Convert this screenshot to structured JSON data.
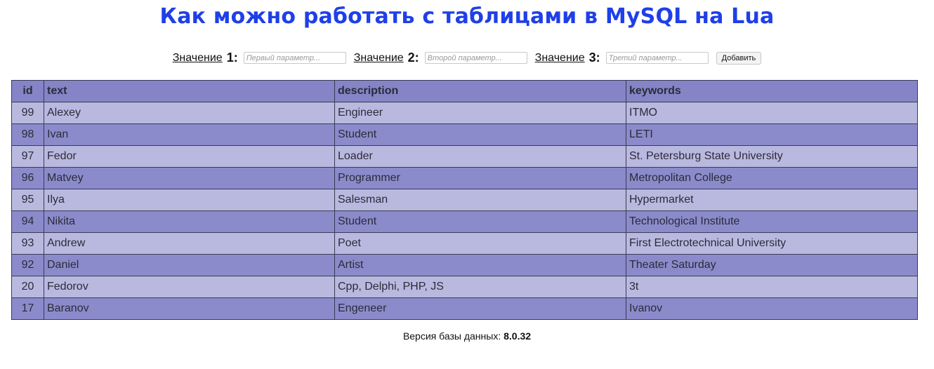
{
  "page": {
    "title": "Как можно работать с таблицами в MySQL на Lua"
  },
  "form": {
    "fields": [
      {
        "label": "Значение",
        "number": "1:",
        "placeholder": "Первый параметр..."
      },
      {
        "label": "Значение",
        "number": "2:",
        "placeholder": "Второй параметр..."
      },
      {
        "label": "Значение",
        "number": "3:",
        "placeholder": "Третий параметр..."
      }
    ],
    "submit_label": "Добавить"
  },
  "table": {
    "headers": [
      "id",
      "text",
      "description",
      "keywords"
    ],
    "rows": [
      [
        "99",
        "Alexey",
        "Engineer",
        "ITMO"
      ],
      [
        "98",
        "Ivan",
        "Student",
        "LETI"
      ],
      [
        "97",
        "Fedor",
        "Loader",
        "St. Petersburg State University"
      ],
      [
        "96",
        "Matvey",
        "Programmer",
        "Metropolitan College"
      ],
      [
        "95",
        "Ilya",
        "Salesman",
        "Hypermarket"
      ],
      [
        "94",
        "Nikita",
        "Student",
        "Technological Institute"
      ],
      [
        "93",
        "Andrew",
        "Poet",
        "First Electrotechnical University"
      ],
      [
        "92",
        "Daniel",
        "Artist",
        "Theater Saturday"
      ],
      [
        "20",
        "Fedorov",
        "Cpp, Delphi, PHP, JS",
        "3t"
      ],
      [
        "17",
        "Baranov",
        "Engeneer",
        "Ivanov"
      ]
    ]
  },
  "footer": {
    "label": "Версия базы данных:",
    "version": "8.0.32"
  },
  "colors": {
    "title": "#1f3fe8",
    "header_row": "#8484c6",
    "row_light": "#b9b9e0",
    "row_dark": "#8b8bcb"
  }
}
